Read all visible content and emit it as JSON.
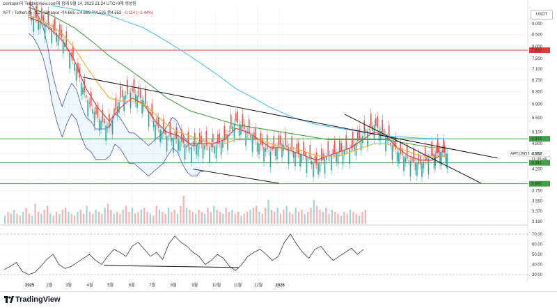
{
  "header": {
    "text": "cointupin이 TradingView.com에 함께 9월 14, 2025 21:24 UTC+9에 생성됨"
  },
  "legend": {
    "symbol": "APT / TetherUS · 1D · Binance",
    "o": "시4.665",
    "h": "고4.669",
    "l": "저4.535",
    "c": "종4.552",
    "change": "−0.114 (−2.44%)"
  },
  "unit": "USDT",
  "footer": {
    "brand": "TradingView"
  },
  "chart_data": {
    "type": "line",
    "symbol": "APTUSDT",
    "price_axis": {
      "ticks": [
        "9.000",
        "8.500",
        "8.000",
        "7.500",
        "7.100",
        "6.700",
        "6.300",
        "5.900",
        "5.500",
        "5.100",
        "4.800",
        "4.552",
        "4.200",
        "3.750",
        "3.550",
        "3.370",
        "3.190"
      ],
      "scale": "log"
    },
    "time_axis": {
      "ticks": [
        "2025",
        "2월",
        "3월",
        "4월",
        "5월",
        "6월",
        "7월",
        "8월",
        "9월",
        "10월",
        "11월",
        "12월",
        "2026"
      ]
    },
    "price_labels": [
      {
        "text": "7.832",
        "color": "#e53935"
      },
      {
        "text": "4.923",
        "color": "#43a047"
      },
      {
        "text": "APTUSDT",
        "color": "#333333"
      },
      {
        "text": "4.552",
        "color": "#333333"
      },
      {
        "text": "11:35:48",
        "color": "#333333"
      },
      {
        "text": "4.341",
        "color": "#43a047"
      },
      {
        "text": "3.890",
        "color": "#43a047"
      }
    ],
    "horizontal_levels": [
      {
        "value": 7.832,
        "color": "#e53935"
      },
      {
        "value": 4.923,
        "color": "#43a047"
      },
      {
        "value": 4.341,
        "color": "#43a047"
      },
      {
        "value": 3.89,
        "color": "#43a047"
      }
    ],
    "price_series": {
      "x": [
        0,
        7,
        14,
        21,
        28,
        35,
        42,
        49,
        56,
        63,
        70,
        77,
        84,
        91,
        98,
        105,
        112,
        119,
        126,
        133,
        140,
        147,
        154,
        161,
        168,
        175,
        182,
        189,
        196,
        203,
        210,
        217,
        224,
        231,
        238,
        245,
        250,
        255
      ],
      "close": [
        9.4,
        9.2,
        8.8,
        8.3,
        7.3,
        6.1,
        5.5,
        5.2,
        6.1,
        6.3,
        6.0,
        5.3,
        5.0,
        4.9,
        4.7,
        4.8,
        4.7,
        4.9,
        5.4,
        5.1,
        4.8,
        4.6,
        4.8,
        4.6,
        4.5,
        4.3,
        4.5,
        4.6,
        4.7,
        5.0,
        5.3,
        5.0,
        4.6,
        4.4,
        4.3,
        4.5,
        4.6,
        4.55
      ]
    },
    "series": [
      {
        "values": [
          9.3,
          9.1,
          8.7,
          8.2,
          7.4,
          6.4,
          5.8,
          5.4,
          5.8,
          6.1,
          5.9,
          5.4,
          5.1,
          5.0,
          4.8,
          4.8,
          4.8,
          4.9,
          5.2,
          5.1,
          4.9,
          4.7,
          4.7,
          4.6,
          4.5,
          4.4,
          4.5,
          4.6,
          4.7,
          4.9,
          5.1,
          5.0,
          4.7,
          4.5,
          4.4,
          4.4,
          4.5,
          4.5
        ],
        "color": "#e53935"
      },
      {
        "values": [
          9.4,
          9.2,
          8.9,
          8.5,
          7.9,
          7.2,
          6.6,
          6.1,
          6.0,
          6.0,
          5.9,
          5.6,
          5.3,
          5.1,
          5.0,
          4.9,
          4.8,
          4.8,
          4.9,
          4.9,
          4.9,
          4.8,
          4.7,
          4.7,
          4.6,
          4.5,
          4.5,
          4.5,
          4.6,
          4.7,
          4.8,
          4.8,
          4.7,
          4.6,
          4.5,
          4.5,
          4.5,
          4.5
        ],
        "color": "#f9a825"
      },
      {
        "values": [
          9.8,
          9.6,
          9.4,
          9.1,
          8.8,
          8.4,
          8.0,
          7.6,
          7.3,
          7.0,
          6.7,
          6.4,
          6.1,
          5.9,
          5.7,
          5.6,
          5.5,
          5.4,
          5.3,
          5.25,
          5.2,
          5.15,
          5.1,
          5.05,
          5.0,
          4.95,
          4.9,
          4.9,
          4.9,
          4.9,
          4.9,
          4.9,
          4.85,
          4.8,
          4.75,
          4.7,
          4.7,
          4.68
        ],
        "color": "#43a047"
      },
      {
        "values": [
          null,
          null,
          9.9,
          9.8,
          9.7,
          9.6,
          9.5,
          9.4,
          9.2,
          9.0,
          8.8,
          8.5,
          8.2,
          7.9,
          7.6,
          7.3,
          7.0,
          6.7,
          6.4,
          6.2,
          6.0,
          5.8,
          5.65,
          5.5,
          5.4,
          5.3,
          5.25,
          5.2,
          5.15,
          5.1,
          5.05,
          5.0,
          4.98,
          4.96,
          4.94,
          4.93,
          4.93,
          4.92
        ],
        "color": "#4fc3f7"
      }
    ],
    "trendlines": [
      {
        "from": [
          33,
          6.8
        ],
        "to": [
          285,
          4.45
        ],
        "color": "#111111"
      },
      {
        "from": [
          192,
          5.6
        ],
        "to": [
          275,
          3.9
        ],
        "color": "#111111"
      },
      {
        "from": [
          100,
          4.2
        ],
        "to": [
          152,
          3.9
        ],
        "color": "#111111"
      }
    ],
    "volume": {
      "values": [
        4,
        6,
        5,
        7,
        5,
        4,
        6,
        8,
        5,
        4,
        10,
        6,
        5,
        7,
        9,
        5,
        4,
        6,
        5,
        7,
        8,
        6,
        5,
        4,
        6,
        7,
        5,
        9,
        6,
        5,
        7,
        6,
        5,
        8,
        10,
        7,
        5,
        6,
        5,
        7,
        9,
        6,
        8,
        5,
        6,
        7,
        8,
        6,
        5,
        4,
        9,
        7,
        6,
        5,
        8,
        6,
        7,
        5,
        9,
        14,
        8,
        7,
        6,
        5,
        7,
        6,
        5,
        8,
        6,
        9,
        7,
        6,
        5,
        8,
        6,
        7,
        5,
        6,
        4,
        5,
        6,
        7,
        8,
        9,
        6,
        5,
        8,
        12,
        7,
        6,
        8,
        5,
        7,
        9,
        6,
        5,
        8,
        6,
        7,
        5,
        6,
        8,
        12,
        9,
        7,
        6,
        8,
        5,
        7,
        6,
        5,
        4,
        6,
        5,
        7,
        6,
        5,
        4,
        6,
        7
      ]
    },
    "rsi": {
      "levels": [
        "70.00",
        "60.00",
        "50.00",
        "40.00",
        "30.00"
      ],
      "values": [
        35,
        38,
        42,
        33,
        30,
        32,
        38,
        45,
        50,
        40,
        36,
        38,
        42,
        46,
        50,
        44,
        40,
        48,
        55,
        52,
        48,
        58,
        62,
        55,
        48,
        52,
        45,
        60,
        68,
        62,
        58,
        52,
        48,
        40,
        44,
        50,
        46,
        38,
        34,
        40,
        48,
        52,
        55,
        50,
        44,
        48,
        62,
        70,
        60,
        52,
        46,
        55,
        58,
        50,
        44,
        48,
        52,
        56,
        50,
        55
      ]
    },
    "rsi_divergence_arrow": {
      "from": [
        100,
        39
      ],
      "to": [
        170,
        37
      ]
    }
  }
}
